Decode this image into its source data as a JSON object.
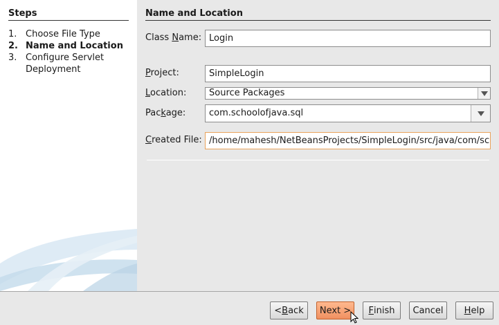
{
  "steps": {
    "title": "Steps",
    "items": [
      {
        "num": "1.",
        "label": "Choose File Type",
        "current": false
      },
      {
        "num": "2.",
        "label": "Name and Location",
        "current": true
      },
      {
        "num": "3.",
        "label": "Configure Servlet Deployment",
        "current": false
      }
    ]
  },
  "form": {
    "title": "Name and Location",
    "class_name": {
      "label_pre": "Class ",
      "label_mn": "N",
      "label_post": "ame:",
      "value": "Login"
    },
    "project": {
      "label_pre": "",
      "label_mn": "P",
      "label_post": "roject:",
      "value": "SimpleLogin"
    },
    "location": {
      "label_pre": "",
      "label_mn": "L",
      "label_post": "ocation:",
      "value": "Source Packages"
    },
    "package": {
      "label_pre": "Pac",
      "label_mn": "k",
      "label_post": "age:",
      "value": "com.schoolofjava.sql"
    },
    "created_file": {
      "label_pre": "",
      "label_mn": "C",
      "label_post": "reated File:",
      "value": "/home/mahesh/NetBeansProjects/SimpleLogin/src/java/com/scl"
    }
  },
  "buttons": {
    "back": {
      "pre": "< ",
      "mn": "B",
      "post": "ack"
    },
    "next": {
      "pre": "",
      "mn": "",
      "post": "Next >"
    },
    "finish": {
      "pre": "",
      "mn": "F",
      "post": "inish"
    },
    "cancel": {
      "pre": "",
      "mn": "",
      "post": "Cancel"
    },
    "help": {
      "pre": "",
      "mn": "H",
      "post": "elp"
    }
  },
  "colors": {
    "primary_button": "#f09060",
    "readonly_border": "#e9a25a"
  },
  "icons": [
    "dropdown-arrow-icon",
    "mouse-cursor-icon"
  ]
}
